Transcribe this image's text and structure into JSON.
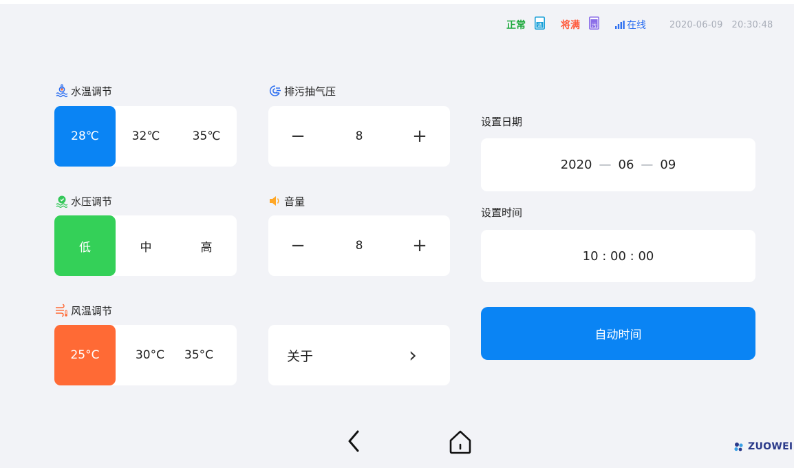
{
  "status": {
    "clean_label": "正常",
    "clean_tank_char": "清",
    "dirty_label": "将满",
    "dirty_tank_char": "污",
    "online_label": "在线",
    "datetime": "2020-06-09   20:30:48"
  },
  "water_temp": {
    "label": "水温调节",
    "options": [
      "28℃",
      "32℃",
      "35℃"
    ],
    "selected": "28℃",
    "accent": "#0a84f4"
  },
  "water_pressure": {
    "label": "水压调节",
    "options": [
      "低",
      "中",
      "高"
    ],
    "selected": "低",
    "accent": "#34d058"
  },
  "air_temp": {
    "label": "风温调节",
    "options": [
      "25°C",
      "30°C",
      "35°C"
    ],
    "selected": "25°C",
    "accent": "#ff6a35"
  },
  "suction": {
    "label": "排污抽气压",
    "minus": "−",
    "value": "8",
    "plus": "+"
  },
  "volume": {
    "label": "音量",
    "minus": "−",
    "value": "8",
    "plus": "+"
  },
  "about": {
    "label": "关于",
    "chevron": "›"
  },
  "date_setting": {
    "label": "设置日期",
    "year": "2020",
    "month": "06",
    "day": "09",
    "separator": "—"
  },
  "time_setting": {
    "label": "设置时间",
    "value": "10 : 00 : 00"
  },
  "auto_time_button": "自动时间",
  "brand": "ZUOWEI",
  "icons": {
    "water_temp": "thermometer-water-icon",
    "water_pressure": "pressure-gauge-icon",
    "air_temp": "wind-temperature-icon",
    "suction": "suction-swirl-icon",
    "volume": "speaker-icon",
    "back": "back-arrow-icon",
    "home": "home-icon",
    "signal": "signal-bars-icon"
  }
}
